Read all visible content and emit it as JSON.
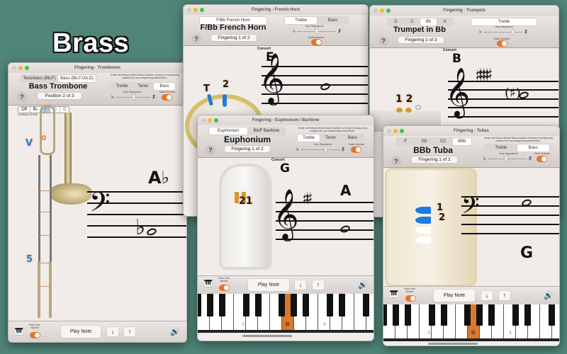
{
  "banner": {
    "title": "Brass"
  },
  "common": {
    "key_signature_label": "Key Signature:",
    "note_names_label": "Note Names",
    "piano_key_names_label": "Piano Key Names",
    "play_note": "Play Note",
    "down_arrow": "↓",
    "up_arrow": "↑",
    "concert_label": "Concert",
    "clef_note_text": "Treble clef follows British Band tradition of being in transposing notation for non-transposing instruments.",
    "help_glyph": "?",
    "flat_glyph": "♭",
    "sharp_glyph": "♯",
    "speaker_glyph": "🔊",
    "piano_glyph": "🎹",
    "note_names_on": true,
    "piano_key_names_on": true,
    "colors": {
      "toggle": "#e7742a",
      "highlight_key": "#d9782e",
      "speaker": "#31a84a",
      "valve_blue": "#1e7be0"
    }
  },
  "trombone": {
    "window_title": "Fingering - Trombones",
    "variants": [
      "Tenorbass (Bb,F)",
      "Bass (Bb,F,Gb,D)"
    ],
    "selected_variant": 1,
    "instrument_name": "Bass Trombone",
    "position_label": "Position 2 of 3",
    "clefs": [
      "Treble",
      "Tenor",
      "Bass"
    ],
    "selected_clef": 2,
    "positions_guide": [
      "Off",
      "B♭",
      "F",
      "G",
      "D"
    ],
    "positions_guide_label": "Positions Guide",
    "concert_note": "A♭",
    "staff_note_accidental": "♭",
    "valve_marker": "V",
    "slide_position_marker": "5"
  },
  "horn": {
    "window_title": "Fingering - French Horn",
    "variants": [
      "F/Bb French Horn"
    ],
    "instrument_name": "F/Bb French Horn",
    "fingering_label": "Fingering 1 of 2",
    "clefs": [
      "Treble",
      "Bass"
    ],
    "selected_clef": 0,
    "concert_note": "E",
    "valve_markers": [
      "T",
      "2"
    ]
  },
  "trumpet": {
    "window_title": "Fingering - Trumpets",
    "variants": [
      "D",
      "C",
      "Bb",
      "A"
    ],
    "selected_variant": 2,
    "instrument_name": "Trumpet in Bb",
    "fingering_label": "Fingering 1 of 3",
    "clefs": [
      "Treble"
    ],
    "selected_clef": 0,
    "concert_note": "B",
    "valve_markers": "1 2"
  },
  "euphonium": {
    "window_title": "Fingering - Euphonium / Baritone",
    "variants": [
      "Euphonium",
      "Bb/F Baritone"
    ],
    "selected_variant": 0,
    "instrument_name": "Euphonium",
    "fingering_label": "Fingering 1 of 2",
    "clefs": [
      "Treble",
      "Tenor",
      "Bass"
    ],
    "selected_clef": 0,
    "concert_note": "G",
    "written_note": "A",
    "valve_markers": "21",
    "octave_labels": [
      "3",
      "4"
    ],
    "highlighted_key": "G"
  },
  "tuba": {
    "window_title": "Fingering - Tubas",
    "variants": [
      "F",
      "Eb",
      "CC",
      "BBb"
    ],
    "selected_variant": 3,
    "instrument_name": "BBb Tuba",
    "fingering_label": "Fingering 1 of 2",
    "clefs": [
      "Treble",
      "Bass"
    ],
    "selected_clef": 1,
    "written_note": "G",
    "valve_markers": [
      "1",
      "2"
    ],
    "octave_labels": [
      "3",
      "4"
    ],
    "highlighted_key": "G"
  }
}
